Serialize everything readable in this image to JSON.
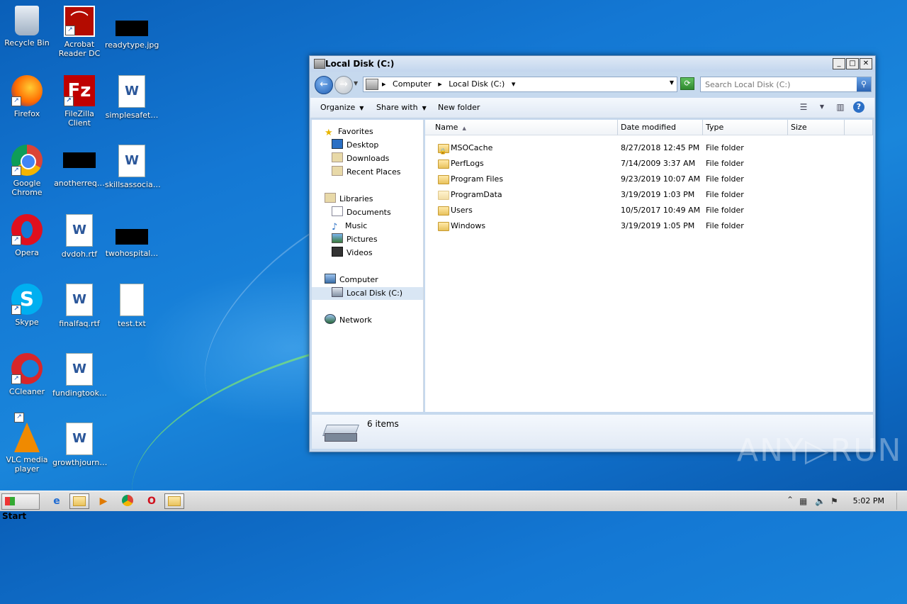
{
  "desktop": {
    "icons": [
      {
        "label": "Recycle Bin"
      },
      {
        "label": "Acrobat Reader DC"
      },
      {
        "label": "readytype.jpg"
      },
      {
        "label": "Firefox"
      },
      {
        "label": "FileZilla Client"
      },
      {
        "label": "simplesafet…"
      },
      {
        "label": "Google Chrome"
      },
      {
        "label": "anotherreq…"
      },
      {
        "label": "skillsassocia…"
      },
      {
        "label": "Opera"
      },
      {
        "label": "dvdoh.rtf"
      },
      {
        "label": "twohospital…"
      },
      {
        "label": "Skype"
      },
      {
        "label": "finalfaq.rtf"
      },
      {
        "label": "test.txt"
      },
      {
        "label": "CCleaner"
      },
      {
        "label": "fundingtook…"
      },
      {
        "label": "VLC media player"
      },
      {
        "label": "growthjourn…"
      }
    ]
  },
  "window": {
    "title": "Local Disk (C:)",
    "address": {
      "crumbs": [
        "Computer",
        "Local Disk (C:)"
      ]
    },
    "search_placeholder": "Search Local Disk (C:)",
    "toolbar": {
      "organize": "Organize",
      "share_with": "Share with",
      "new_folder": "New folder"
    },
    "nav": {
      "favorites": "Favorites",
      "desktop": "Desktop",
      "downloads": "Downloads",
      "recent": "Recent Places",
      "libraries": "Libraries",
      "documents": "Documents",
      "music": "Music",
      "pictures": "Pictures",
      "videos": "Videos",
      "computer": "Computer",
      "local_disk": "Local Disk (C:)",
      "network": "Network"
    },
    "columns": {
      "name": "Name",
      "date": "Date modified",
      "type": "Type",
      "size": "Size"
    },
    "files": [
      {
        "name": "MSOCache",
        "date": "8/27/2018 12:45 PM",
        "type": "File folder"
      },
      {
        "name": "PerfLogs",
        "date": "7/14/2009 3:37 AM",
        "type": "File folder"
      },
      {
        "name": "Program Files",
        "date": "9/23/2019 10:07 AM",
        "type": "File folder"
      },
      {
        "name": "ProgramData",
        "date": "3/19/2019 1:03 PM",
        "type": "File folder"
      },
      {
        "name": "Users",
        "date": "10/5/2017 10:49 AM",
        "type": "File folder"
      },
      {
        "name": "Windows",
        "date": "3/19/2019 1:05 PM",
        "type": "File folder"
      }
    ],
    "status": "6 items"
  },
  "taskbar": {
    "start": "Start",
    "clock": "5:02 PM"
  },
  "watermark": "ANY▷RUN"
}
